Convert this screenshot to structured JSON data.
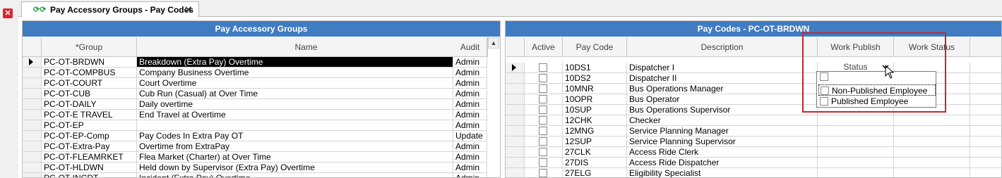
{
  "tab": {
    "title": "Pay Accessory Groups - Pay Codes",
    "icon": "refresh-arrows-icon",
    "close": "✕"
  },
  "left": {
    "title": "Pay Accessory Groups",
    "headers": [
      "*Group",
      "Name",
      "Audit"
    ],
    "rows": [
      {
        "group": "PC-OT-BRDWN",
        "name": "Breakdown (Extra Pay) Overtime",
        "audit": "Admin"
      },
      {
        "group": "PC-OT-COMPBUS",
        "name": "Company Business Overtime",
        "audit": "Admin"
      },
      {
        "group": "PC-OT-COURT",
        "name": "Court Overtime",
        "audit": "Admin"
      },
      {
        "group": "PC-OT-CUB",
        "name": "Cub Run (Casual) at Over Time",
        "audit": "Admin"
      },
      {
        "group": "PC-OT-DAILY",
        "name": "Daily overtime",
        "audit": "Admin"
      },
      {
        "group": "PC-OT-E TRAVEL",
        "name": "End Travel at Overtime",
        "audit": "Admin"
      },
      {
        "group": "PC-OT-EP",
        "name": "",
        "audit": "Admin"
      },
      {
        "group": "PC-OT-EP-Comp",
        "name": "Pay Codes In Extra Pay OT",
        "audit": "Update"
      },
      {
        "group": "PC-OT-Extra-Pay",
        "name": "Overtime from ExtraPay",
        "audit": "Admin"
      },
      {
        "group": "PC-OT-FLEAMRKET",
        "name": "Flea Market (Charter) at Over Time",
        "audit": "Admin"
      },
      {
        "group": "PC-OT-HLDWN",
        "name": "Held down by Supervisor (Extra Pay) Overtime",
        "audit": "Admin"
      },
      {
        "group": "PC-OT-INCDT",
        "name": "Incident (Extra Pay) Overtime",
        "audit": "Admin"
      }
    ]
  },
  "right": {
    "title": "Pay Codes - PC-OT-BRDWN",
    "headers": [
      "Active",
      "Pay Code",
      "Description",
      "Work Publish Status",
      "Work Status"
    ],
    "rows": [
      {
        "code": "10DS1",
        "desc": "Dispatcher I"
      },
      {
        "code": "10DS2",
        "desc": "Dispatcher II"
      },
      {
        "code": "10MNR",
        "desc": "Bus Operations Manager"
      },
      {
        "code": "10OPR",
        "desc": "Bus Operator"
      },
      {
        "code": "10SUP",
        "desc": "Bus Operations Supervisor"
      },
      {
        "code": "12CHK",
        "desc": "Checker"
      },
      {
        "code": "12MNG",
        "desc": "Service Planning Manager"
      },
      {
        "code": "12SUP",
        "desc": "Service Planning Supervisor"
      },
      {
        "code": "27CLK",
        "desc": "Access Ride Clerk"
      },
      {
        "code": "27DIS",
        "desc": "Access Ride Dispatcher"
      },
      {
        "code": "27ELG",
        "desc": "Eligibility Specialist"
      }
    ],
    "dropdown": {
      "options": [
        "Non-Published Employee",
        "Published Employee"
      ]
    }
  },
  "colors": {
    "title_bar": "#3f7cc2",
    "highlight_box": "#c1272d",
    "close_button": "#d9262e"
  }
}
